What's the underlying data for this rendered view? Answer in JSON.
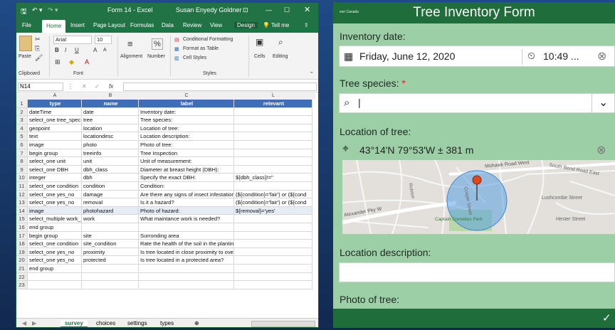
{
  "excel": {
    "window_title": "Form 14  -  Excel",
    "user": "Susan Enyedy Goldner",
    "tabs": [
      "File",
      "Home",
      "Insert",
      "Page Layout",
      "Formulas",
      "Data",
      "Review",
      "View",
      "Design"
    ],
    "tell_me": "Tell me",
    "font_name": "Arial",
    "font_size": "10",
    "ribbon": {
      "paste": "Paste",
      "clipboard": "Clipboard",
      "font": "Font",
      "alignment": "Alignment",
      "number": "Number",
      "cond_format": "Conditional Formatting",
      "format_table": "Format as Table",
      "cell_styles": "Cell Styles",
      "styles": "Styles",
      "cells": "Cells",
      "editing": "Editing",
      "percent": "%",
      "bold": "B",
      "italic": "I",
      "underline": "U",
      "grow": "A",
      "shrink": "A"
    },
    "name_box": "N14",
    "fx": "fx",
    "columns": [
      "A",
      "B",
      "C",
      "L"
    ],
    "headers": [
      "type",
      "name",
      "label",
      "relevant"
    ],
    "rows": [
      [
        "dateTime",
        "date",
        "Inventory date:",
        ""
      ],
      [
        "select_one tree_spec",
        "tree",
        "Tree species:",
        ""
      ],
      [
        "geopoint",
        "location",
        "Location of tree:",
        ""
      ],
      [
        "text",
        "locationdesc",
        "Location description:",
        ""
      ],
      [
        "image",
        "photo",
        "Photo of tree:",
        ""
      ],
      [
        "begin group",
        "treeinfo",
        "Tree Inspection",
        ""
      ],
      [
        "select_one unit",
        "unit",
        "Unit of measurement:",
        ""
      ],
      [
        "select_one DBH",
        "dbh_class",
        "Diameter at breast height (DBH):",
        ""
      ],
      [
        "integer",
        "dbh",
        "Specify the exact DBH:",
        "${dbh_class}!=''"
      ],
      [
        "select_one condition",
        "condition",
        "Condition:",
        ""
      ],
      [
        "select_one yes_no",
        "damage",
        "Are there any signs of insect infestations and diseases?",
        "(${condition}='fair') or (${cond"
      ],
      [
        "select_one yes_no",
        "removal",
        "Is it a hazard?",
        "(${condition}='fair') or (${cond"
      ],
      [
        "image",
        "photohazard",
        "Photo of hazard:",
        "${removal}='yes'"
      ],
      [
        "select_multiple work_",
        "work",
        "What maintance work is needed?",
        ""
      ],
      [
        "end group",
        "",
        "",
        ""
      ],
      [
        "begin group",
        "site",
        "Surronding area",
        ""
      ],
      [
        "select_one condition",
        "site_condition",
        "Rate the health of the soil in the planting space",
        ""
      ],
      [
        "select_one yes_no",
        "proximity",
        "Is tree located in close proximity to overhead/underhead utilities or fall",
        ""
      ],
      [
        "select_one yes_no",
        "protected",
        "Is tree located in a protected area?",
        ""
      ],
      [
        "end group",
        "",
        "",
        ""
      ],
      [
        "",
        "",
        "",
        ""
      ],
      [
        "",
        "",
        "",
        ""
      ]
    ],
    "row_numbers": [
      "1",
      "2",
      "3",
      "4",
      "5",
      "6",
      "7",
      "8",
      "9",
      "10",
      "11",
      "12",
      "13",
      "14",
      "15",
      "16",
      "17",
      "18",
      "19",
      "20",
      "21",
      "22",
      "23"
    ],
    "sheets": [
      "survey",
      "choices",
      "settings",
      "types"
    ]
  },
  "survey": {
    "title": "Tree Inventory Form",
    "logo": "esri Canada",
    "q1": "Inventory date:",
    "date": "Friday, June 12, 2020",
    "time": "10:49 ...",
    "q2": "Tree species:",
    "required": "*",
    "q3": "Location of tree:",
    "location": "43°14'N 79°53'W ± 381 m",
    "map_labels": {
      "road1": "Mohawk Road West",
      "road2": "South Bend Road East",
      "road3": "Lushcombe Street",
      "road4": "Hester Street",
      "road5": "Alexander Pky W",
      "park": "Captain Cornelius Park",
      "ave1": "Rolston",
      "ave2": "Cooper Street"
    },
    "q4": "Location description:",
    "q5": "Photo of tree:"
  },
  "colors": {
    "excel_green": "#217346",
    "header_blue": "#3c6fb6",
    "survey_green": "#1e6d3b",
    "survey_bg": "#9ccfa6",
    "pin": "#d9481f"
  }
}
